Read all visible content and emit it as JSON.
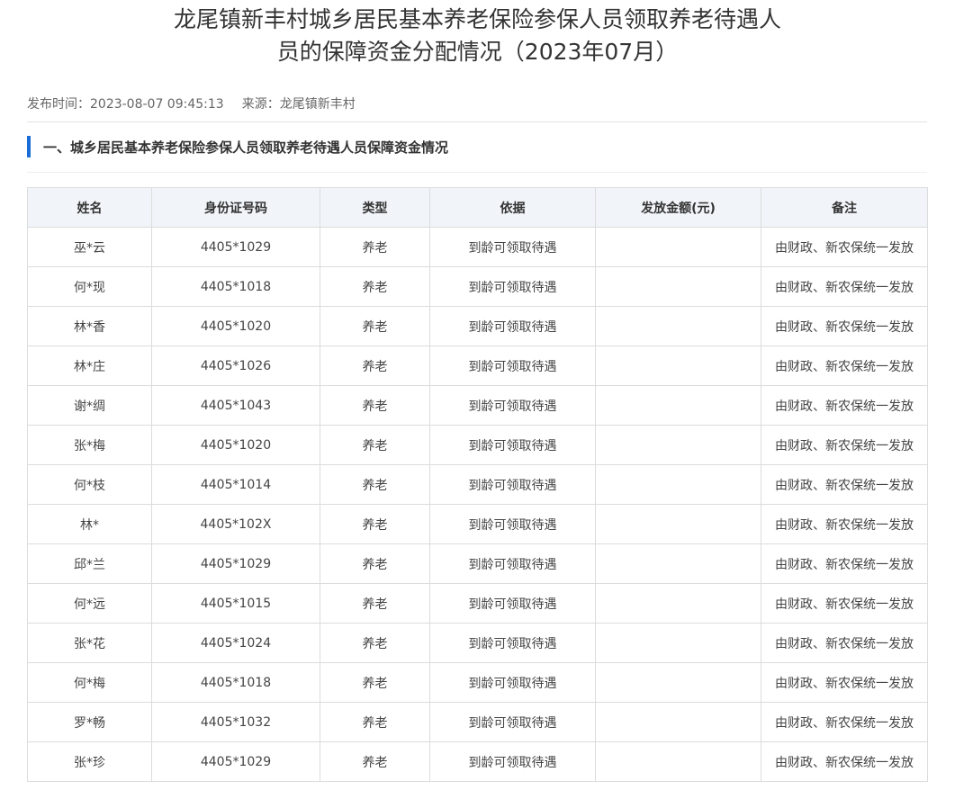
{
  "article": {
    "title_line1": "龙尾镇新丰村城乡居民基本养老保险参保人员领取养老待遇人",
    "title_line2": "员的保障资金分配情况（2023年07月）",
    "publish_label": "发布时间：",
    "publish_time": "2023-08-07 09:45:13",
    "source_label": "来源：",
    "source": "龙尾镇新丰村"
  },
  "section": {
    "heading": "一、城乡居民基本养老保险参保人员领取养老待遇人员保障资金情况",
    "accent_color": "#1a6dd6"
  },
  "table": {
    "columns": [
      "姓名",
      "身份证号码",
      "类型",
      "依据",
      "发放金额(元)",
      "备注"
    ],
    "rows": [
      [
        "巫*云",
        "4405*1029",
        "养老",
        "到龄可领取待遇",
        "",
        "由财政、新农保统一发放"
      ],
      [
        "何*现",
        "4405*1018",
        "养老",
        "到龄可领取待遇",
        "",
        "由财政、新农保统一发放"
      ],
      [
        "林*香",
        "4405*1020",
        "养老",
        "到龄可领取待遇",
        "",
        "由财政、新农保统一发放"
      ],
      [
        "林*庄",
        "4405*1026",
        "养老",
        "到龄可领取待遇",
        "",
        "由财政、新农保统一发放"
      ],
      [
        "谢*绸",
        "4405*1043",
        "养老",
        "到龄可领取待遇",
        "",
        "由财政、新农保统一发放"
      ],
      [
        "张*梅",
        "4405*1020",
        "养老",
        "到龄可领取待遇",
        "",
        "由财政、新农保统一发放"
      ],
      [
        "何*枝",
        "4405*1014",
        "养老",
        "到龄可领取待遇",
        "",
        "由财政、新农保统一发放"
      ],
      [
        "林*",
        "4405*102X",
        "养老",
        "到龄可领取待遇",
        "",
        "由财政、新农保统一发放"
      ],
      [
        "邱*兰",
        "4405*1029",
        "养老",
        "到龄可领取待遇",
        "",
        "由财政、新农保统一发放"
      ],
      [
        "何*远",
        "4405*1015",
        "养老",
        "到龄可领取待遇",
        "",
        "由财政、新农保统一发放"
      ],
      [
        "张*花",
        "4405*1024",
        "养老",
        "到龄可领取待遇",
        "",
        "由财政、新农保统一发放"
      ],
      [
        "何*梅",
        "4405*1018",
        "养老",
        "到龄可领取待遇",
        "",
        "由财政、新农保统一发放"
      ],
      [
        "罗*畅",
        "4405*1032",
        "养老",
        "到龄可领取待遇",
        "",
        "由财政、新农保统一发放"
      ],
      [
        "张*珍",
        "4405*1029",
        "养老",
        "到龄可领取待遇",
        "",
        "由财政、新农保统一发放"
      ]
    ]
  }
}
